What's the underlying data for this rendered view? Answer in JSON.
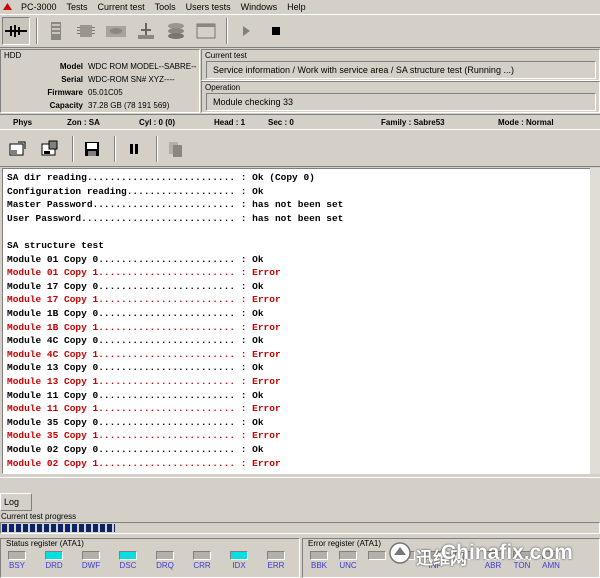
{
  "menu": {
    "items": [
      "PC-3000",
      "Tests",
      "Current test",
      "Tools",
      "Users tests",
      "Windows",
      "Help"
    ]
  },
  "hdd": {
    "title": "HDD",
    "rows": [
      {
        "label": "Model",
        "value": "WDC ROM MODEL--SABRE--"
      },
      {
        "label": "Serial",
        "value": "WDC-ROM SN# XYZ----"
      },
      {
        "label": "Firmware",
        "value": "05.01C05"
      },
      {
        "label": "Capacity",
        "value": "37.28 GB (78 191 569)"
      }
    ]
  },
  "current_test": {
    "title": "Current test",
    "value": "Service information / Work with service area / SA structure test (Running ...)"
  },
  "operation": {
    "title": "Operation",
    "value": "Module checking 33"
  },
  "phys": {
    "phys": "Phys",
    "zone": "Zon : SA",
    "cyl": "Cyl : 0 (0)",
    "head": "Head : 1",
    "sec": "Sec : 0",
    "family": "Family : Sabre53",
    "mode": "Mode : Normal"
  },
  "log": {
    "lines": [
      {
        "text": "SA dir reading.......................... : Ok (Copy 0)",
        "error": false
      },
      {
        "text": "Configuration reading................... : Ok",
        "error": false
      },
      {
        "text": "Master Password......................... : has not been set",
        "error": false
      },
      {
        "text": "User Password........................... : has not been set",
        "error": false
      },
      {
        "text": "",
        "error": false
      },
      {
        "text": "SA structure test",
        "error": false
      },
      {
        "text": "Module 01 Copy 0........................ : Ok",
        "error": false
      },
      {
        "text": "Module 01 Copy 1........................ : Error",
        "error": true
      },
      {
        "text": "Module 17 Copy 0........................ : Ok",
        "error": false
      },
      {
        "text": "Module 17 Copy 1........................ : Error",
        "error": true
      },
      {
        "text": "Module 1B Copy 0........................ : Ok",
        "error": false
      },
      {
        "text": "Module 1B Copy 1........................ : Error",
        "error": true
      },
      {
        "text": "Module 4C Copy 0........................ : Ok",
        "error": false
      },
      {
        "text": "Module 4C Copy 1........................ : Error",
        "error": true
      },
      {
        "text": "Module 13 Copy 0........................ : Ok",
        "error": false
      },
      {
        "text": "Module 13 Copy 1........................ : Error",
        "error": true
      },
      {
        "text": "Module 11 Copy 0........................ : Ok",
        "error": false
      },
      {
        "text": "Module 11 Copy 1........................ : Error",
        "error": true
      },
      {
        "text": "Module 35 Copy 0........................ : Ok",
        "error": false
      },
      {
        "text": "Module 35 Copy 1........................ : Error",
        "error": true
      },
      {
        "text": "Module 02 Copy 0........................ : Ok",
        "error": false
      },
      {
        "text": "Module 02 Copy 1........................ : Error",
        "error": true
      }
    ]
  },
  "log_tab": {
    "label": "Log"
  },
  "progress": {
    "label": "Current test progress",
    "fraction": 0.19
  },
  "status_register": {
    "title": "Status register (ATA1)",
    "flags": [
      {
        "name": "BSY",
        "on": false
      },
      {
        "name": "DRD",
        "on": true
      },
      {
        "name": "DWF",
        "on": false
      },
      {
        "name": "DSC",
        "on": true
      },
      {
        "name": "DRQ",
        "on": false
      },
      {
        "name": "CRR",
        "on": false
      },
      {
        "name": "IDX",
        "on": true
      },
      {
        "name": "ERR",
        "on": false
      }
    ]
  },
  "error_register": {
    "title": "Error register (ATA1)",
    "flags": [
      {
        "name": "BBK",
        "on": false
      },
      {
        "name": "UNC",
        "on": false
      },
      {
        "name": "",
        "on": false
      },
      {
        "name": "",
        "on": false
      },
      {
        "name": "INF",
        "on": false
      },
      {
        "name": "",
        "on": false
      },
      {
        "name": "ABR",
        "on": false
      },
      {
        "name": "TON",
        "on": false
      },
      {
        "name": "AMN",
        "on": false
      }
    ]
  },
  "watermark": {
    "cn": "迅维网",
    "en": "Chinafix.com"
  },
  "colors": {
    "error": "#cc0000",
    "led_on": "#00e0e0",
    "reg_text": "#3b3bd0"
  }
}
